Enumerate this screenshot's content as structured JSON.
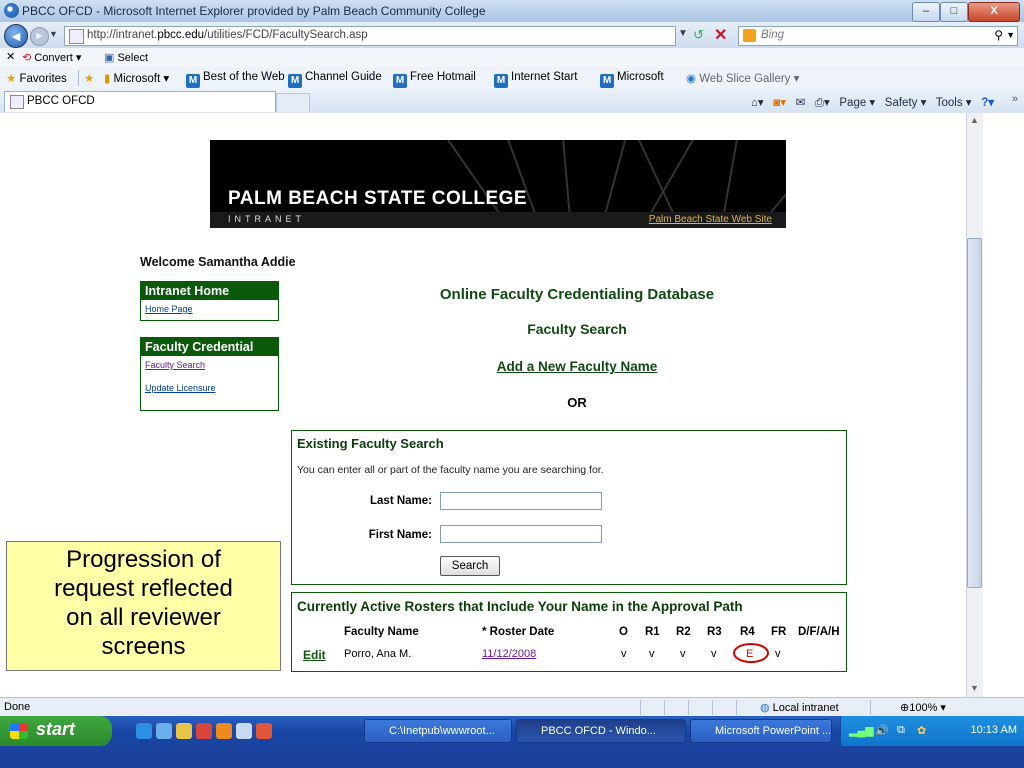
{
  "window": {
    "title": "PBCC OFCD - Microsoft Internet Explorer provided by Palm Beach Community College",
    "controls": {
      "minimize": "–",
      "maximize": "□",
      "close": "X"
    }
  },
  "browser": {
    "url_prefix": "http://intranet.",
    "url_host": "pbcc.edu",
    "url_path": "/utilities/FCD/FacultySearch.asp",
    "search_placeholder": "Bing",
    "back_glyph": "◄",
    "forward_glyph": "►",
    "convert_label": "Convert",
    "select_label": "Select",
    "favorites": {
      "favorites_label": "Favorites",
      "microsoft_label": "Microsoft ▾",
      "items": [
        "Best of the Web",
        "Channel Guide",
        "Free Hotmail",
        "Internet Start",
        "Microsoft"
      ],
      "web_slice_label": "Web Slice Gallery ▾"
    },
    "tab_title": "PBCC OFCD",
    "command_bar": {
      "page": "Page ▾",
      "safety": "Safety ▾",
      "tools": "Tools ▾",
      "help": "?▾"
    }
  },
  "banner": {
    "brand": "PALM BEACH STATE COLLEGE",
    "intranet": "INTRANET",
    "link": "Palm Beach State Web Site"
  },
  "welcome": "Welcome Samantha Addie",
  "sidebar": {
    "intranet_home": {
      "header": "Intranet Home",
      "links": [
        "Home Page"
      ]
    },
    "faculty_credential": {
      "header": "Faculty Credential",
      "links": [
        "Faculty Search",
        "Update Licensure"
      ]
    }
  },
  "main": {
    "title": "Online Faculty Credentialing Database",
    "subtitle": "Faculty Search",
    "add_link": "Add a New Faculty Name",
    "or": "OR"
  },
  "existing_search": {
    "header": "Existing Faculty Search",
    "hint": "You can enter all or part of the faculty name you are searching for.",
    "last_name_label": "Last Name:",
    "first_name_label": "First Name:",
    "last_name_value": "",
    "first_name_value": "",
    "search_button": "Search"
  },
  "rosters": {
    "header": "Currently Active Rosters that Include Your Name in the Approval Path",
    "columns": [
      "Faculty Name",
      "* Roster Date",
      "O",
      "R1",
      "R2",
      "R3",
      "R4",
      "FR",
      "D/F/A/H"
    ],
    "rows": [
      {
        "action": "Edit",
        "name": "Porro, Ana M.",
        "date": "11/12/2008",
        "o": "v",
        "r1": "v",
        "r2": "v",
        "r3": "v",
        "r4": "E",
        "fr": "v",
        "dfah": ""
      }
    ]
  },
  "callout": {
    "lines": [
      "Progression of",
      "request reflected",
      "on all reviewer",
      "screens"
    ]
  },
  "status": {
    "text": "Done",
    "zone": "Local intranet",
    "zoom": "100%"
  },
  "taskbar": {
    "start": "start",
    "buttons": [
      "C:\\Inetpub\\wwwroot...",
      "PBCC OFCD - Windo...",
      "Microsoft PowerPoint ..."
    ],
    "clock": "10:13 AM"
  },
  "colors": {
    "accent_green": "#0b5a0b",
    "title_green": "#0f4a12",
    "link_blue": "#003d9e",
    "callout_yellow": "#ffffa8",
    "highlight_red": "#d00000",
    "banner_link_gold": "#e0b04b"
  }
}
